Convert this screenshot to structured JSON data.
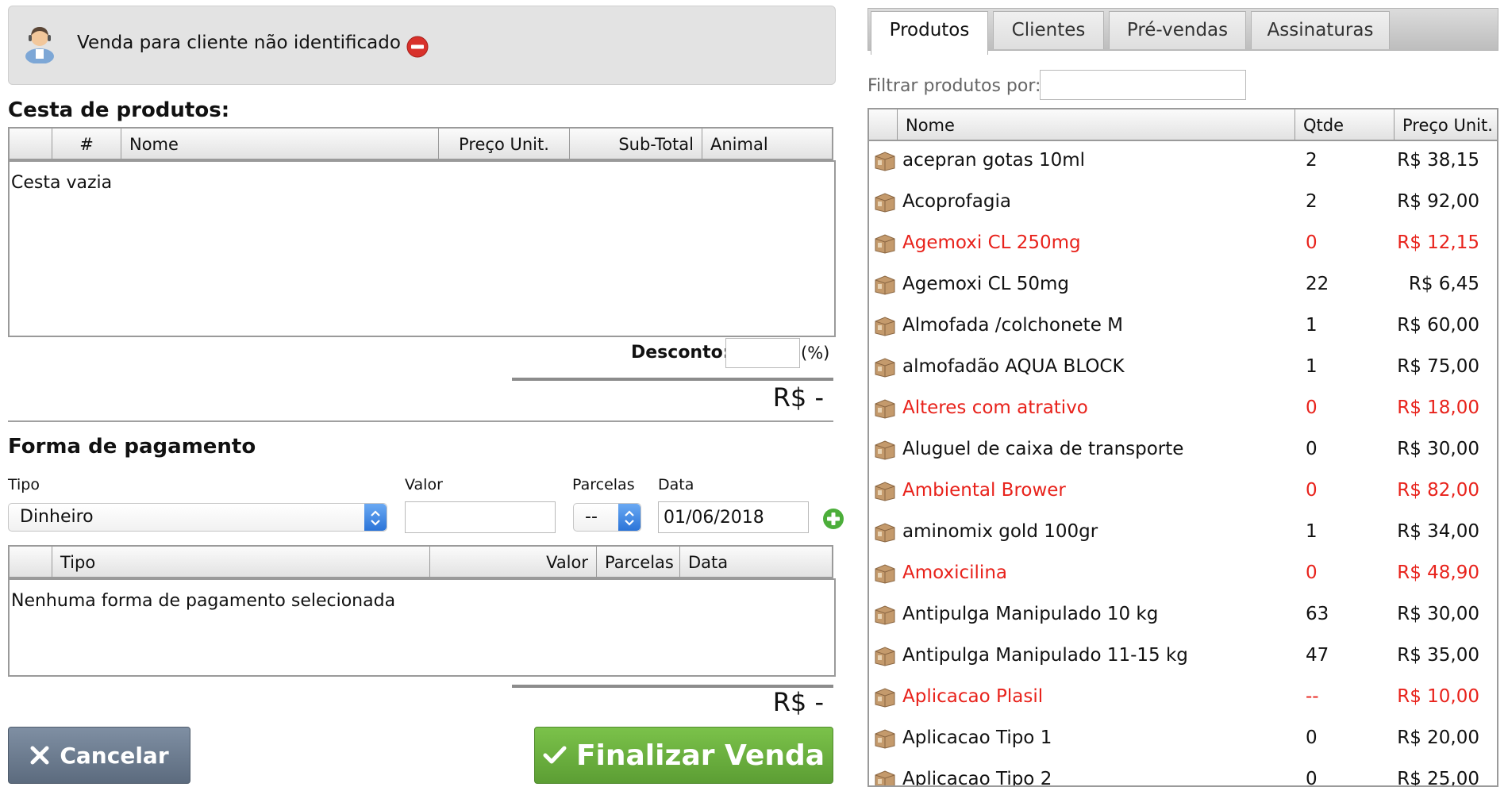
{
  "customer": {
    "text": "Venda para cliente não identificado"
  },
  "basket": {
    "title": "Cesta de produtos:",
    "headers": [
      "#",
      "Nome",
      "Preço Unit.",
      "Sub-Total",
      "Animal"
    ],
    "empty_text": "Cesta vazia",
    "discount_label": "Desconto:",
    "discount_value": "",
    "discount_unit": "(%)",
    "total": "R$ -"
  },
  "payment": {
    "title": "Forma de pagamento",
    "labels": {
      "tipo": "Tipo",
      "valor": "Valor",
      "parcelas": "Parcelas",
      "data": "Data"
    },
    "tipo_selected": "Dinheiro",
    "valor_value": "",
    "parcelas_selected": "--",
    "data_value": "01/06/2018",
    "headers": [
      "Tipo",
      "Valor",
      "Parcelas",
      "Data"
    ],
    "empty_text": "Nenhuma forma de pagamento selecionada",
    "total": "R$ -"
  },
  "actions": {
    "cancel_label": "Cancelar",
    "finish_label": "Finalizar Venda"
  },
  "tabs": [
    {
      "label": "Produtos",
      "active": true
    },
    {
      "label": "Clientes",
      "active": false
    },
    {
      "label": "Pré-vendas",
      "active": false
    },
    {
      "label": "Assinaturas",
      "active": false
    }
  ],
  "filter": {
    "label": "Filtrar produtos por:",
    "value": ""
  },
  "products": {
    "headers": [
      "Nome",
      "Qtde",
      "Preço Unit."
    ],
    "rows": [
      {
        "name": "acepran gotas 10ml",
        "qty": "2",
        "price": "R$ 38,15",
        "out_of_stock": false
      },
      {
        "name": "Acoprofagia",
        "qty": "2",
        "price": "R$ 92,00",
        "out_of_stock": false
      },
      {
        "name": "Agemoxi CL 250mg",
        "qty": "0",
        "price": "R$ 12,15",
        "out_of_stock": true
      },
      {
        "name": "Agemoxi CL 50mg",
        "qty": "22",
        "price": "R$ 6,45",
        "out_of_stock": false
      },
      {
        "name": "Almofada /colchonete M",
        "qty": "1",
        "price": "R$ 60,00",
        "out_of_stock": false
      },
      {
        "name": "almofadão AQUA BLOCK",
        "qty": "1",
        "price": "R$ 75,00",
        "out_of_stock": false
      },
      {
        "name": "Alteres com atrativo",
        "qty": "0",
        "price": "R$ 18,00",
        "out_of_stock": true
      },
      {
        "name": "Aluguel de caixa de transporte",
        "qty": "0",
        "price": "R$ 30,00",
        "out_of_stock": false
      },
      {
        "name": "Ambiental Brower",
        "qty": "0",
        "price": "R$ 82,00",
        "out_of_stock": true
      },
      {
        "name": "aminomix gold 100gr",
        "qty": "1",
        "price": "R$ 34,00",
        "out_of_stock": false
      },
      {
        "name": "Amoxicilina",
        "qty": "0",
        "price": "R$ 48,90",
        "out_of_stock": true
      },
      {
        "name": "Antipulga Manipulado 10 kg",
        "qty": "63",
        "price": "R$ 30,00",
        "out_of_stock": false
      },
      {
        "name": "Antipulga Manipulado 11-15 kg",
        "qty": "47",
        "price": "R$ 35,00",
        "out_of_stock": false
      },
      {
        "name": "Aplicacao Plasil",
        "qty": "--",
        "price": "R$ 10,00",
        "out_of_stock": true
      },
      {
        "name": "Aplicacao Tipo 1",
        "qty": "0",
        "price": "R$ 20,00",
        "out_of_stock": false
      },
      {
        "name": "Aplicacao Tipo 2",
        "qty": "0",
        "price": "R$ 25,00",
        "out_of_stock": false
      }
    ]
  },
  "colors": {
    "out_of_stock": "#e8221b",
    "finish_button": "#6db33f",
    "cancel_button": "#6e7f93"
  }
}
